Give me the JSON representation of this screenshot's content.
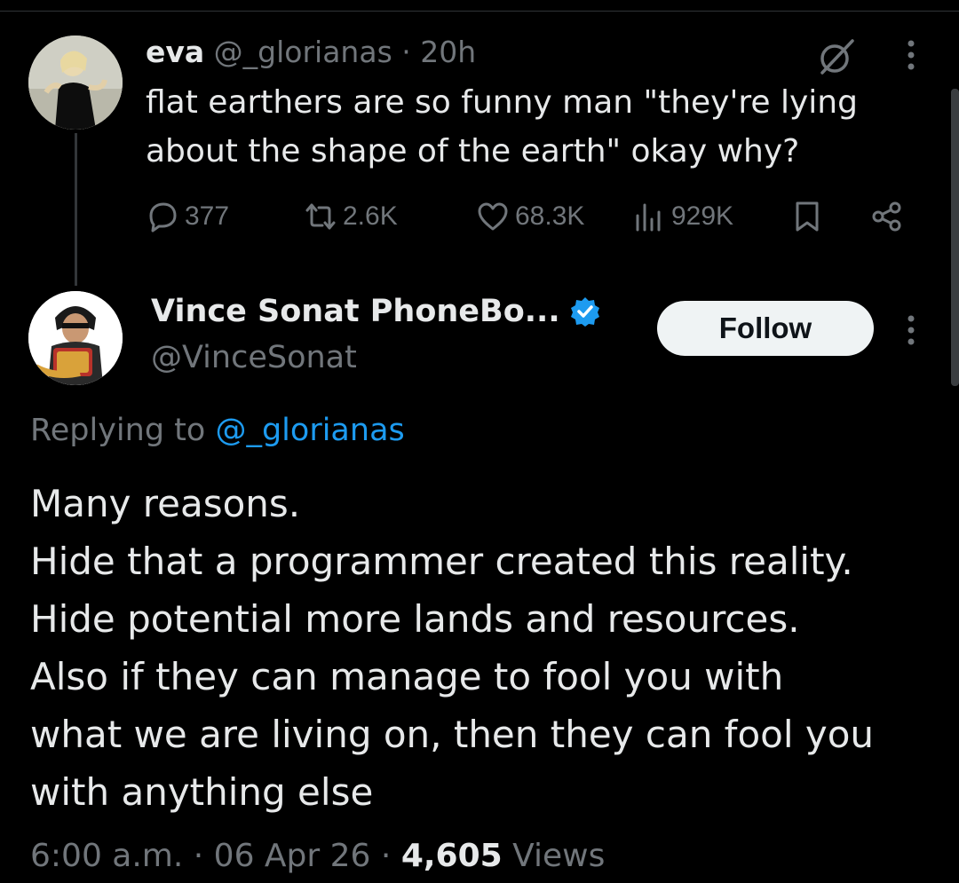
{
  "parent_tweet": {
    "display_name": "eva",
    "handle": "@_glorianas",
    "separator": "·",
    "time": "20h",
    "text": "flat earthers are so funny man \"they're lying about the shape of the earth\" okay why?",
    "actions": {
      "replies": "377",
      "reposts": "2.6K",
      "likes": "68.3K",
      "views": "929K"
    },
    "icons": [
      "grok-icon",
      "more-icon",
      "reply-icon",
      "repost-icon",
      "like-icon",
      "views-icon",
      "bookmark-icon",
      "share-icon"
    ]
  },
  "reply_tweet": {
    "display_name": "Vince Sonat PhoneBo...",
    "handle": "@VinceSonat",
    "follow_label": "Follow",
    "replying_prefix": "Replying to",
    "replying_to": "@_glorianas",
    "text_lines": [
      "Many reasons.",
      "Hide that a programmer created this reality.",
      "Hide potential more lands and resources.",
      "Also if they can manage to fool you with",
      "what we are living on, then they can fool you",
      "with anything else"
    ],
    "time": "6:00 a.m.",
    "date": "06 Apr 26",
    "separator": "·",
    "views_count": "4,605",
    "views_label": "Views"
  },
  "colors": {
    "background": "#000000",
    "text": "#e7e9ea",
    "muted": "#71767b",
    "accent": "#1d9bf0",
    "follow_bg": "#eff3f4"
  }
}
